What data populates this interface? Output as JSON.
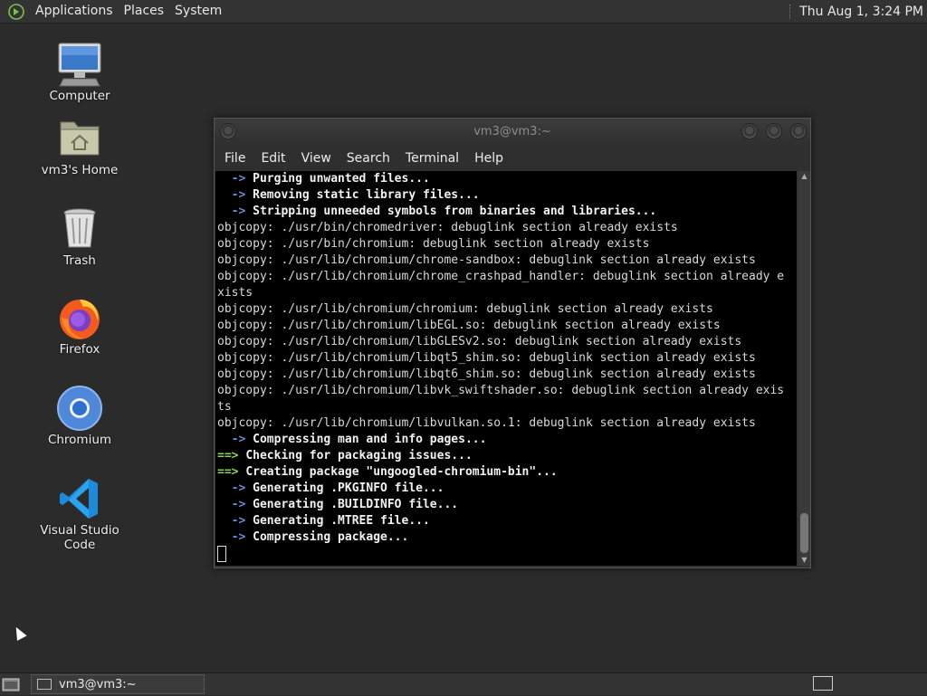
{
  "top_panel": {
    "menus": [
      "Applications",
      "Places",
      "System"
    ],
    "clock": "Thu Aug  1,  3:24 PM"
  },
  "desktop_icons": [
    {
      "label": "Computer",
      "icon": "computer-icon"
    },
    {
      "label": "vm3's Home",
      "icon": "home-folder-icon"
    },
    {
      "label": "Trash",
      "icon": "trash-icon"
    },
    {
      "label": "Firefox",
      "icon": "firefox-icon"
    },
    {
      "label": "Chromium",
      "icon": "chromium-icon"
    },
    {
      "label": "Visual Studio Code",
      "icon": "vscode-icon"
    }
  ],
  "terminal_window": {
    "title": "vm3@vm3:~",
    "menu": [
      "File",
      "Edit",
      "View",
      "Search",
      "Terminal",
      "Help"
    ],
    "lines": [
      {
        "prefix": "  -> ",
        "text": "Purging unwanted files...",
        "kind": "arrow"
      },
      {
        "prefix": "  -> ",
        "text": "Removing static library files...",
        "kind": "arrow"
      },
      {
        "prefix": "  -> ",
        "text": "Stripping unneeded symbols from binaries and libraries...",
        "kind": "arrow"
      },
      {
        "prefix": "",
        "text": "objcopy: ./usr/bin/chromedriver: debuglink section already exists",
        "kind": "plain"
      },
      {
        "prefix": "",
        "text": "objcopy: ./usr/bin/chromium: debuglink section already exists",
        "kind": "plain"
      },
      {
        "prefix": "",
        "text": "objcopy: ./usr/lib/chromium/chrome-sandbox: debuglink section already exists",
        "kind": "plain"
      },
      {
        "prefix": "",
        "text": "objcopy: ./usr/lib/chromium/chrome_crashpad_handler: debuglink section already e",
        "kind": "plain"
      },
      {
        "prefix": "",
        "text": "xists",
        "kind": "plain"
      },
      {
        "prefix": "",
        "text": "objcopy: ./usr/lib/chromium/chromium: debuglink section already exists",
        "kind": "plain"
      },
      {
        "prefix": "",
        "text": "objcopy: ./usr/lib/chromium/libEGL.so: debuglink section already exists",
        "kind": "plain"
      },
      {
        "prefix": "",
        "text": "objcopy: ./usr/lib/chromium/libGLESv2.so: debuglink section already exists",
        "kind": "plain"
      },
      {
        "prefix": "",
        "text": "objcopy: ./usr/lib/chromium/libqt5_shim.so: debuglink section already exists",
        "kind": "plain"
      },
      {
        "prefix": "",
        "text": "objcopy: ./usr/lib/chromium/libqt6_shim.so: debuglink section already exists",
        "kind": "plain"
      },
      {
        "prefix": "",
        "text": "objcopy: ./usr/lib/chromium/libvk_swiftshader.so: debuglink section already exis",
        "kind": "plain"
      },
      {
        "prefix": "",
        "text": "ts",
        "kind": "plain"
      },
      {
        "prefix": "",
        "text": "objcopy: ./usr/lib/chromium/libvulkan.so.1: debuglink section already exists",
        "kind": "plain"
      },
      {
        "prefix": "  -> ",
        "text": "Compressing man and info pages...",
        "kind": "arrow"
      },
      {
        "prefix": "==> ",
        "text": "Checking for packaging issues...",
        "kind": "green"
      },
      {
        "prefix": "==> ",
        "text": "Creating package \"ungoogled-chromium-bin\"...",
        "kind": "green"
      },
      {
        "prefix": "  -> ",
        "text": "Generating .PKGINFO file...",
        "kind": "arrow"
      },
      {
        "prefix": "  -> ",
        "text": "Generating .BUILDINFO file...",
        "kind": "arrow"
      },
      {
        "prefix": "  -> ",
        "text": "Generating .MTREE file...",
        "kind": "arrow"
      },
      {
        "prefix": "  -> ",
        "text": "Compressing package...",
        "kind": "arrow"
      }
    ]
  },
  "bottom_panel": {
    "task_label": "vm3@vm3:~"
  }
}
